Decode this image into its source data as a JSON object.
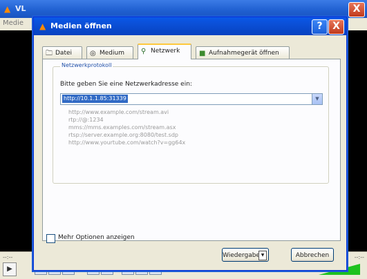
{
  "background": {
    "app_title": "VL",
    "menu_text": "Medie",
    "close_glyph": "X",
    "time_left": "--:--",
    "time_right": "--:--",
    "play_icon": "play-icon"
  },
  "dialog": {
    "title": "Medien öffnen",
    "help_glyph": "?",
    "close_glyph": "X",
    "tabs": [
      {
        "label": "Datei",
        "icon": "folder-icon"
      },
      {
        "label": "Medium",
        "icon": "disc-icon"
      },
      {
        "label": "Netzwerk",
        "icon": "network-icon",
        "active": true
      },
      {
        "label": "Aufnahmegerät öffnen",
        "icon": "capture-device-icon"
      }
    ],
    "group_label": "Netzwerkprotokoll",
    "prompt": "Bitte geben Sie eine Netzwerkadresse ein:",
    "address_value": "http://10.1.1.85:31339",
    "examples": [
      "http://www.example.com/stream.avi",
      "rtp://@:1234",
      "mms://mms.examples.com/stream.asx",
      "rtsp://server.example.org:8080/test.sdp",
      "http://www.yourtube.com/watch?v=gg64x"
    ],
    "more_options_label": "Mehr Optionen anzeigen",
    "more_options_checked": false,
    "play_button": "Wiedergabe",
    "cancel_button": "Abbrechen"
  },
  "colors": {
    "titlebar": "#0b4fd6",
    "dialog_bg": "#ece9d8",
    "selection": "#316ac5",
    "group_label": "#1f4fa8"
  }
}
